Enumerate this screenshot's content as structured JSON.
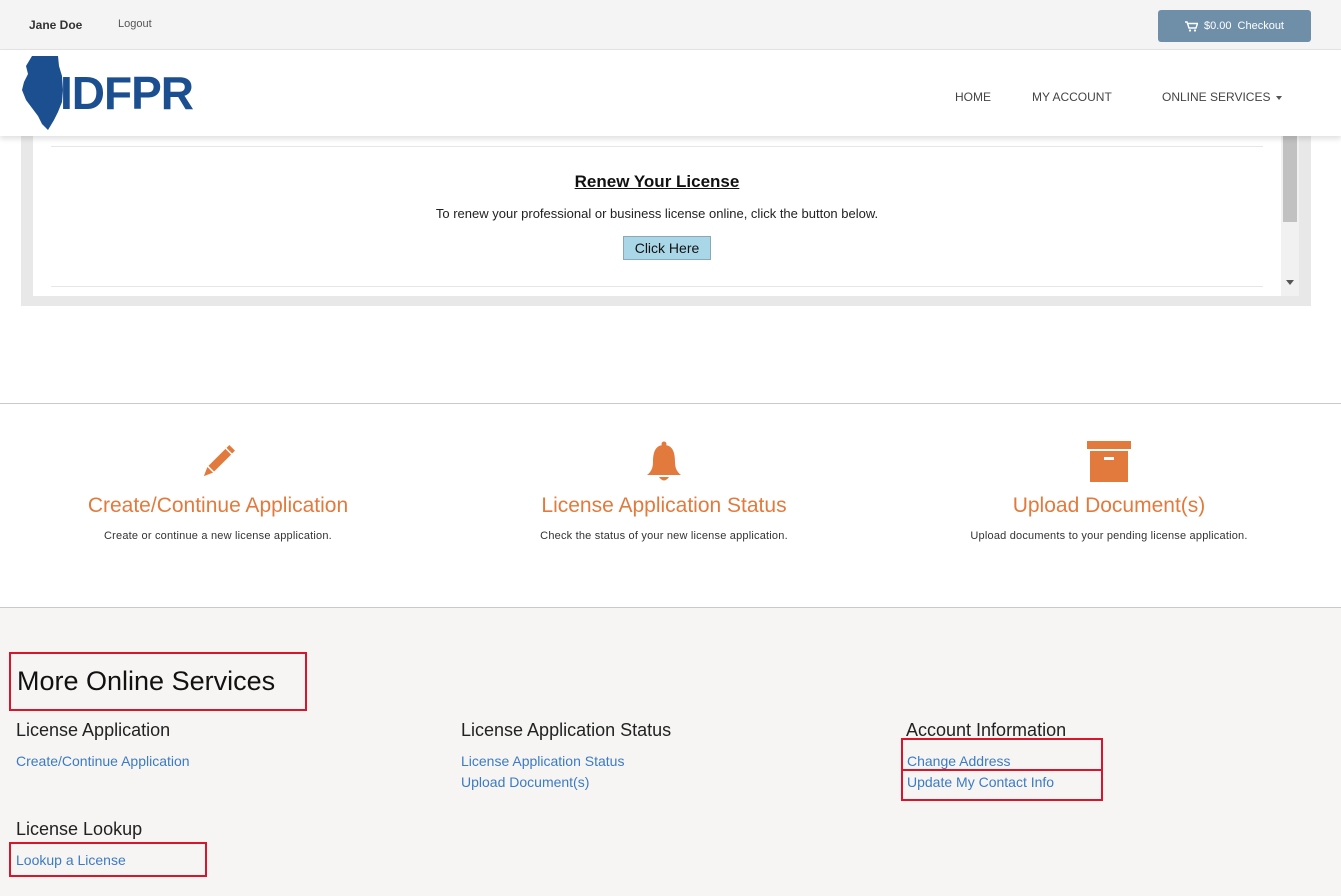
{
  "topbar": {
    "user_name": "Jane Doe",
    "logout_label": "Logout",
    "cart_amount": "$0.00",
    "checkout_label": "Checkout"
  },
  "header": {
    "logo_text": "IDFPR",
    "nav": {
      "home": "HOME",
      "my_account": "MY ACCOUNT",
      "online_services": "ONLINE SERVICES"
    }
  },
  "renew": {
    "title": "Renew Your License",
    "text": "To renew your professional or business license online, click the button below.",
    "button_label": "Click Here"
  },
  "features": [
    {
      "icon": "pencil-icon",
      "title": "Create/Continue Application",
      "desc": "Create or continue a new license application."
    },
    {
      "icon": "bell-icon",
      "title": "License Application Status",
      "desc": "Check the status of your new license application."
    },
    {
      "icon": "archive-box-icon",
      "title": "Upload Document(s)",
      "desc": "Upload documents to your pending license application."
    }
  ],
  "more_services": {
    "title": "More Online Services",
    "license_application": {
      "title": "License Application",
      "links": [
        "Create/Continue Application"
      ]
    },
    "license_status": {
      "title": "License Application Status",
      "links": [
        "License Application Status",
        "Upload Document(s)"
      ]
    },
    "account_information": {
      "title": "Account Information",
      "links": [
        "Change Address",
        "Update My Contact Info"
      ]
    },
    "license_lookup": {
      "title": "License Lookup",
      "links": [
        "Lookup a License"
      ]
    }
  },
  "colors": {
    "accent_orange": "#e37a3d",
    "link_blue": "#3b7bc4",
    "logo_blue": "#1c4f8f",
    "highlight_red": "#d9142b"
  }
}
